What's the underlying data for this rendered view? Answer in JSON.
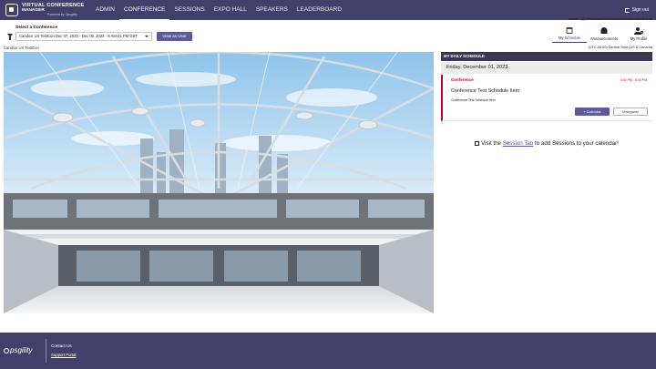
{
  "header": {
    "logo_line1": "VIRTUAL CONFERENCE",
    "logo_line2": "MANAGER",
    "logo_line3": "Powered by Opsgility",
    "nav": [
      {
        "label": "ADMIN",
        "active": false
      },
      {
        "label": "CONFERENCE",
        "active": true
      },
      {
        "label": "SESSIONS",
        "active": false
      },
      {
        "label": "EXPO HALL",
        "active": false
      },
      {
        "label": "SPEAKERS",
        "active": false
      },
      {
        "label": "LEADERBOARD",
        "active": false
      }
    ],
    "signout_label": "Sign out"
  },
  "conference_bar": {
    "select_label": "Select a Conference",
    "selected_conference": "Candice UX TestCon Dec 07, 2023 - Dec 09, 2023 - 8 AM-21 PM DST",
    "view_as_user_label": "View as User",
    "user_email": "admin-1@virtualconferencedemo.onmicrosoft.com",
    "icon_nav": [
      {
        "label": "My Schedule",
        "icon": "calendar-icon",
        "active": true
      },
      {
        "label": "Announcements",
        "icon": "bell-icon",
        "active": false
      },
      {
        "label": "My Profile",
        "icon": "profile-icon",
        "active": false
      }
    ],
    "timezone": "(UTC-06:00) Central Time (US & Canada)"
  },
  "main": {
    "conference_name": "Candice UX TestCon"
  },
  "schedule": {
    "header": "MY DAILY SCHEDULE",
    "date": "Friday, December 01, 2023",
    "item": {
      "type": "Conference",
      "time": "4:00 PM - 5:00 PM",
      "title": "Conference Test Schedule Item",
      "subtitle": "Conference Test Schedule Item",
      "calendar_button": "+ Calendar",
      "unregister_button": "Unregister"
    },
    "visit_prefix": "Visit the ",
    "visit_link": "Session Tab",
    "visit_suffix": " to add Sessions to your calendar!"
  },
  "footer": {
    "logo_text": "psgility",
    "contact_label": "Contact Us",
    "support_label": "Support Portal"
  },
  "colors": {
    "nav_bg": "#433f6b",
    "accent": "#5c5a9a",
    "schedule_header": "#3b3752",
    "conference_red": "#c00033"
  }
}
